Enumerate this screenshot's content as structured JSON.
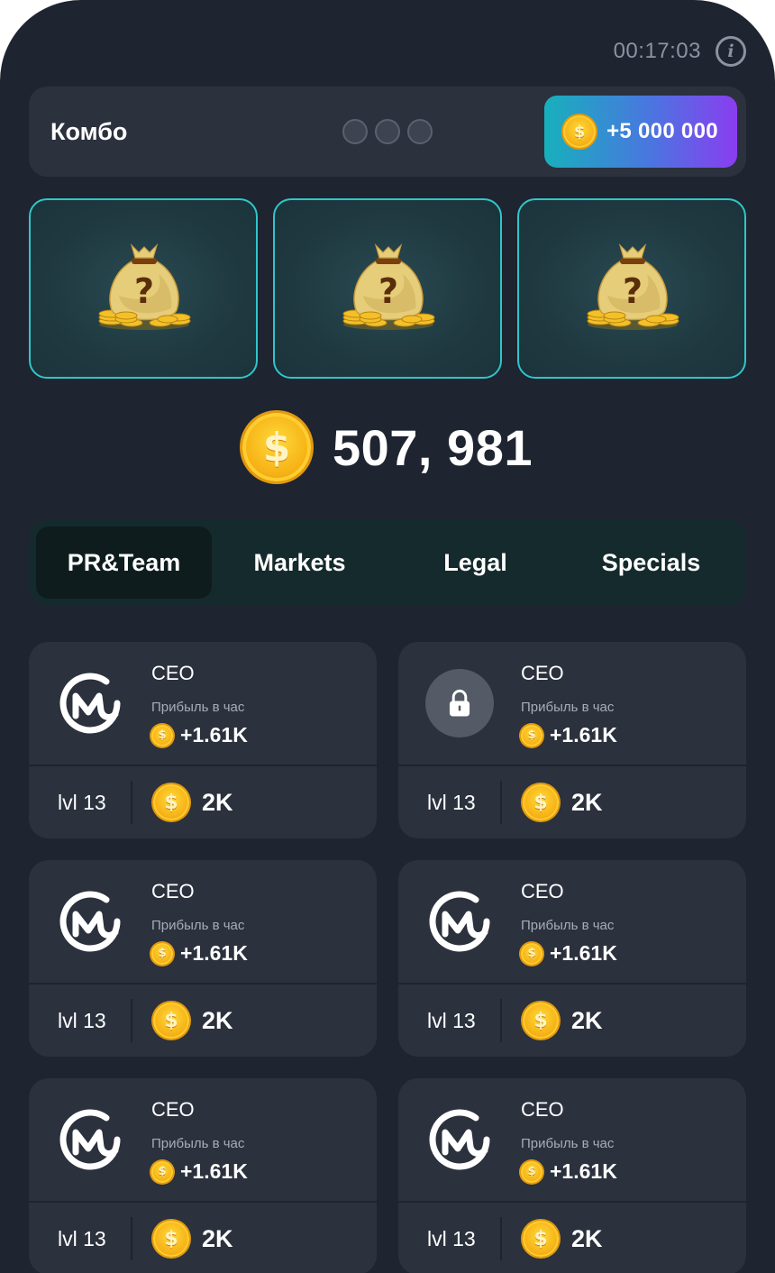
{
  "header": {
    "timer": "00:17:03",
    "info_icon": "info-icon"
  },
  "combo": {
    "title": "Комбо",
    "dots": [
      0,
      0,
      0
    ],
    "reward": "+5 000 000",
    "reward_gradient": [
      "#17b0bc",
      "#8a3df0"
    ]
  },
  "mystery_cards": [
    {
      "icon": "money-bag-question-icon"
    },
    {
      "icon": "money-bag-question-icon"
    },
    {
      "icon": "money-bag-question-icon"
    }
  ],
  "balance": {
    "value": "507, 981",
    "coin_symbol": "$"
  },
  "tabs": [
    {
      "label": "PR&Team",
      "active": true
    },
    {
      "label": "Markets",
      "active": false
    },
    {
      "label": "Legal",
      "active": false
    },
    {
      "label": "Specials",
      "active": false
    }
  ],
  "cards": [
    {
      "title": "CEO",
      "subtitle": "Прибыль в час",
      "profit": "+1.61K",
      "level": "lvl 13",
      "price": "2K",
      "icon": "coinmarketcap-logo-icon",
      "locked": false
    },
    {
      "title": "CEO",
      "subtitle": "Прибыль в час",
      "profit": "+1.61K",
      "level": "lvl 13",
      "price": "2K",
      "icon": "lock-icon",
      "locked": true
    },
    {
      "title": "CEO",
      "subtitle": "Прибыль в час",
      "profit": "+1.61K",
      "level": "lvl 13",
      "price": "2K",
      "icon": "coinmarketcap-logo-icon",
      "locked": false
    },
    {
      "title": "CEO",
      "subtitle": "Прибыль в час",
      "profit": "+1.61K",
      "level": "lvl 13",
      "price": "2K",
      "icon": "coinmarketcap-logo-icon",
      "locked": false
    },
    {
      "title": "CEO",
      "subtitle": "Прибыль в час",
      "profit": "+1.61K",
      "level": "lvl 13",
      "price": "2K",
      "icon": "coinmarketcap-logo-icon",
      "locked": false
    },
    {
      "title": "CEO",
      "subtitle": "Прибыль в час",
      "profit": "+1.61K",
      "level": "lvl 13",
      "price": "2K",
      "icon": "coinmarketcap-logo-icon",
      "locked": false
    }
  ],
  "colors": {
    "background": "#1e2430",
    "card": "#2b313d",
    "accent_teal": "#2fc6c9",
    "coin_gold": "#f6b216",
    "tabs_bg": "#152a2c"
  }
}
